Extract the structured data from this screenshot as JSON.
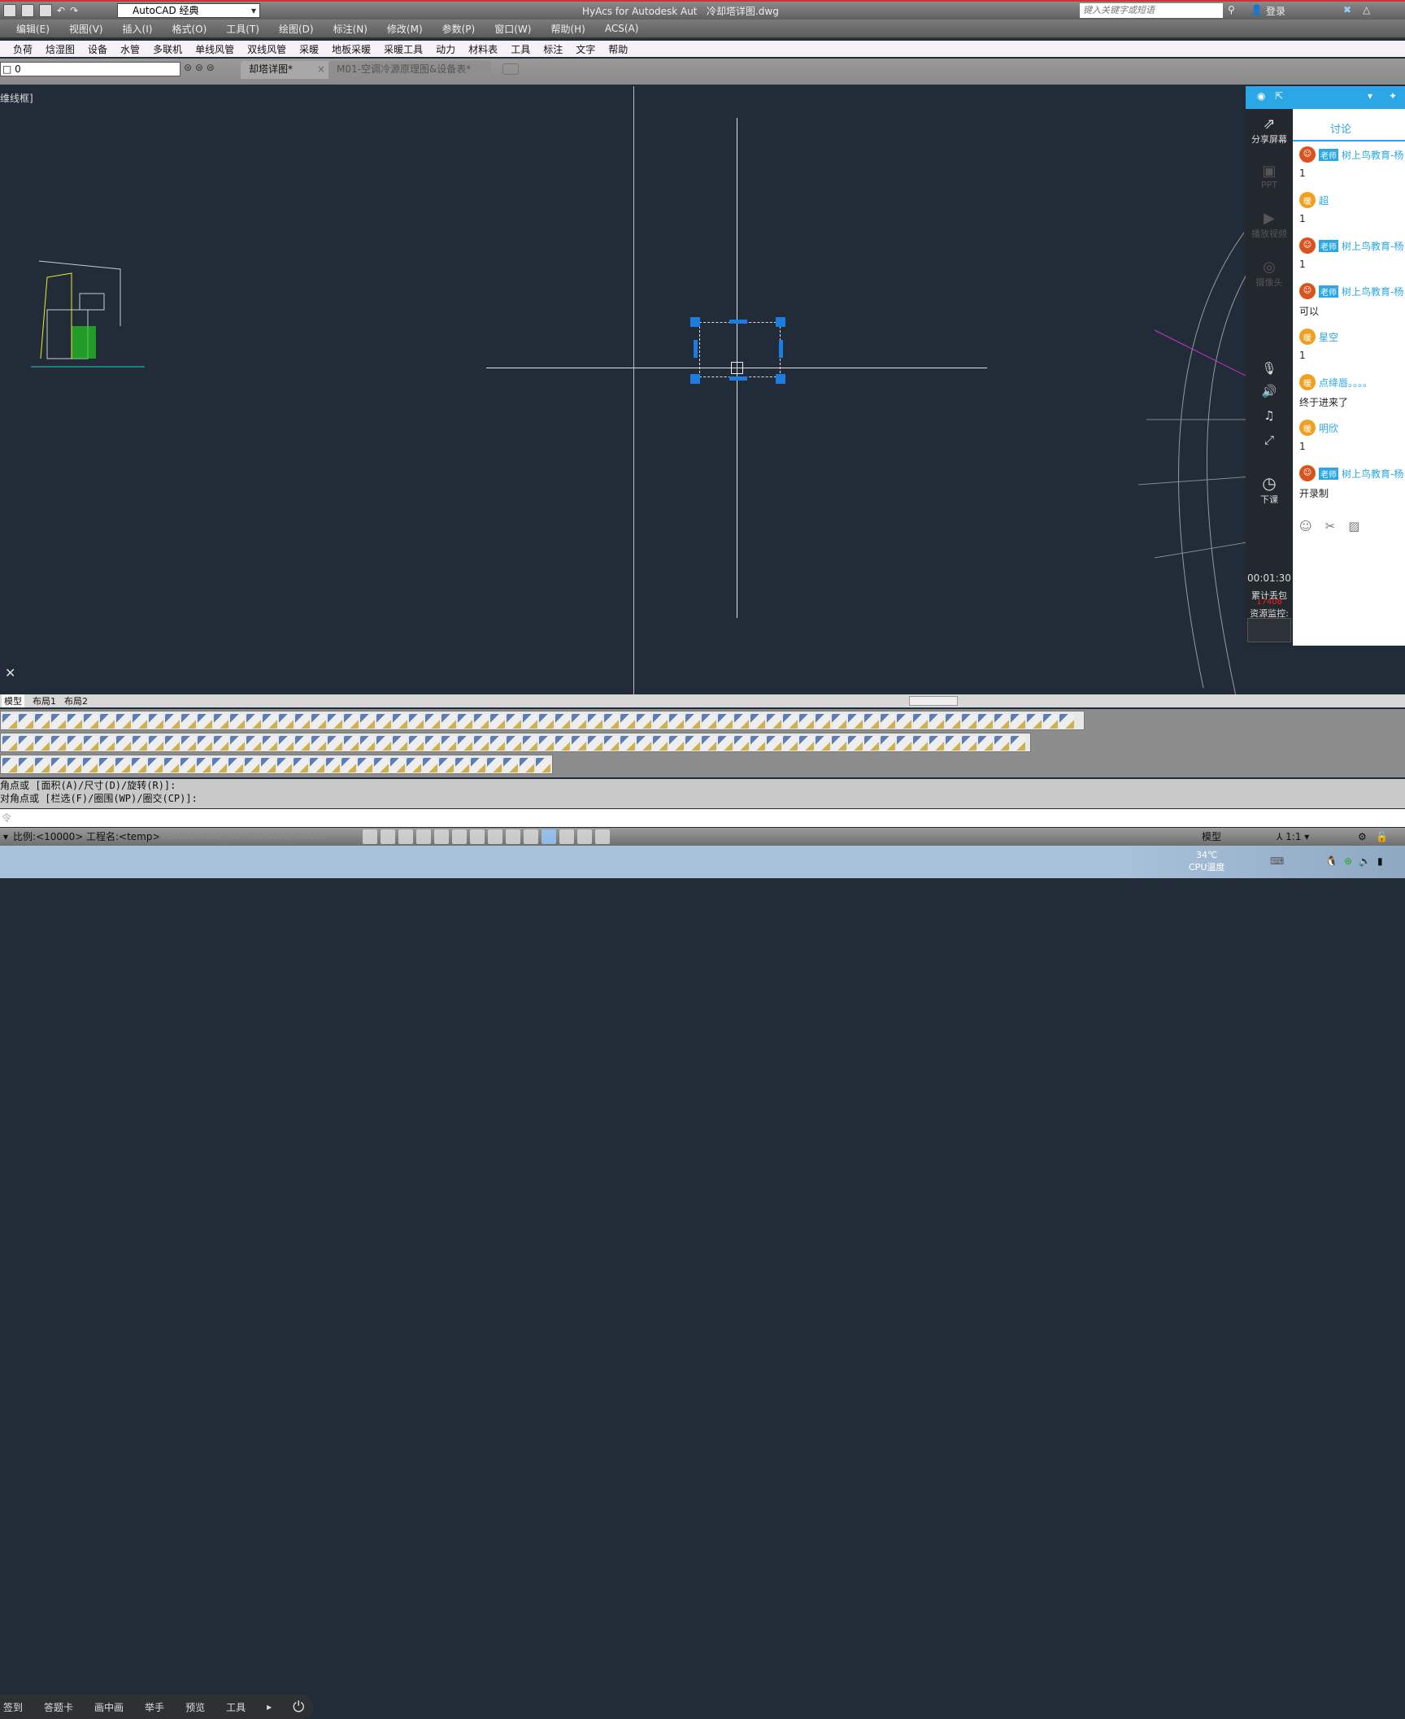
{
  "title_bar": {
    "workspace": "AutoCAD 经典",
    "app_title": "HyAcs for Autodesk Aut",
    "file_title": "冷却塔详图.dwg",
    "search_placeholder": "键入关键字或短语",
    "login": "登录"
  },
  "menu": [
    "编辑(E)",
    "视图(V)",
    "插入(I)",
    "格式(O)",
    "工具(T)",
    "绘图(D)",
    "标注(N)",
    "修改(M)",
    "参数(P)",
    "窗口(W)",
    "帮助(H)",
    "ACS(A)"
  ],
  "plugin_menu": [
    "负荷",
    "焓湿图",
    "设备",
    "水管",
    "多联机",
    "单线风管",
    "双线风管",
    "采暖",
    "地板采暖",
    "采暖工具",
    "动力",
    "材料表",
    "工具",
    "标注",
    "文字",
    "帮助"
  ],
  "layer_value": "0",
  "doc_tabs": [
    {
      "label": "却塔详图*",
      "active": true
    },
    {
      "label": "M01-空调冷源原理图&设备表*",
      "active": false
    }
  ],
  "view_label": "维线框]",
  "layout_tabs": [
    "模型",
    "布局1",
    "布局2"
  ],
  "command_history": [
    "角点或 [面积(A)/尺寸(D)/旋转(R)]:",
    "对角点或 [栏选(F)/圈围(WP)/圈交(CP)]:"
  ],
  "command_placeholder": "令",
  "status": {
    "scale": "比例:<10000>",
    "project": "工程名:<temp>",
    "coords": "-724020.4303, -107791.4318, 0.0000",
    "model": "模型",
    "annotation_scale": "1:1"
  },
  "class_toolbar": [
    "签到",
    "答题卡",
    "画中画",
    "举手",
    "预览",
    "工具"
  ],
  "tray": {
    "temp": "34℃",
    "temp_label": "CPU温度"
  },
  "panel": {
    "side": {
      "share": "分享屏幕",
      "ppt": "PPT",
      "video": "播放视频",
      "camera": "摄像头",
      "end_class": "下课",
      "timer": "00:01:30",
      "packet_loss_label": "累计丢包",
      "packet_loss": "17408",
      "monitor": "资源监控:"
    },
    "tab": "讨论",
    "messages": [
      {
        "role": "老师",
        "name": "树上鸟教育-杨",
        "text": "1",
        "teacher": true
      },
      {
        "role": "暖",
        "name": "超",
        "text": "1",
        "teacher": false
      },
      {
        "role": "老师",
        "name": "树上鸟教育-杨",
        "text": "1",
        "teacher": true
      },
      {
        "role": "老师",
        "name": "树上鸟教育-杨",
        "text": "可以",
        "teacher": true
      },
      {
        "role": "暖",
        "name": "星空",
        "text": "1",
        "teacher": false
      },
      {
        "role": "暖",
        "name": "点绛唇。。。。",
        "text": "终于进来了",
        "teacher": false
      },
      {
        "role": "暖",
        "name": "明欣",
        "text": "1",
        "teacher": false
      },
      {
        "role": "老师",
        "name": "树上鸟教育-杨",
        "text": "开录制",
        "teacher": true
      }
    ]
  },
  "colors": {
    "canvas": "#222b38",
    "grip": "#1d7ce0",
    "accent": "#2aa7e4"
  }
}
